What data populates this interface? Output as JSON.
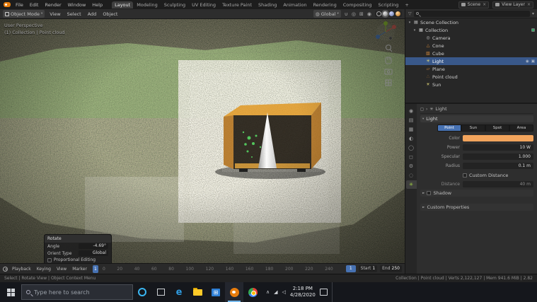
{
  "colors": {
    "accent": "#e87d0d",
    "selection_blue": "#4772b3",
    "crate_top": "#e09a28",
    "crate_side": "#b2701a",
    "crate_front": "#1a140b",
    "cone": "#ededed",
    "marker_dots": "#3ec24b",
    "light_color_swatch": "#f2a45c"
  },
  "glyphs": {
    "caret": "▾",
    "collapsed": "►",
    "expanded": "▾",
    "close": "×",
    "check": "✓",
    "chevron_right": "›",
    "tray_chevron": "∧",
    "tray_net": "◢",
    "tray_vol": "◁",
    "eye": "◉",
    "screen": "▣",
    "funnel": "▽",
    "proportional": "◎",
    "magnet": "∪",
    "globe": "◍",
    "grid": "⊞"
  },
  "topbar": {
    "menus": [
      {
        "label": "File"
      },
      {
        "label": "Edit"
      },
      {
        "label": "Render"
      },
      {
        "label": "Window"
      },
      {
        "label": "Help"
      }
    ],
    "tabs": [
      {
        "label": "Layout"
      },
      {
        "label": "Modeling"
      },
      {
        "label": "Sculpting"
      },
      {
        "label": "UV Editing"
      },
      {
        "label": "Texture Paint"
      },
      {
        "label": "Shading"
      },
      {
        "label": "Animation"
      },
      {
        "label": "Rendering"
      },
      {
        "label": "Compositing"
      },
      {
        "label": "Scripting"
      },
      {
        "label": "+"
      }
    ],
    "scene_label": "Scene",
    "view_layer_label": "View Layer"
  },
  "viewport_header": {
    "mode": "Object Mode",
    "menus": [
      {
        "label": "View"
      },
      {
        "label": "Select"
      },
      {
        "label": "Add"
      },
      {
        "label": "Object"
      }
    ],
    "orientation": "Global"
  },
  "viewport": {
    "overlay_lines": [
      "User Perspective",
      "(1) Collection | Point cloud"
    ]
  },
  "rotate_panel": {
    "title": "Rotate",
    "rows": [
      {
        "label": "Angle",
        "value": "-4.69°"
      },
      {
        "label": "Orient Type",
        "value": "Global"
      }
    ],
    "checkbox_label": "Proportional Editing"
  },
  "outliner": {
    "rows": [
      {
        "label": "Scene Collection",
        "icon": "▤"
      },
      {
        "label": "Collection",
        "icon": "▦"
      },
      {
        "label": "Camera",
        "icon": "◎"
      },
      {
        "label": "Cone",
        "icon": "△"
      },
      {
        "label": "Cube",
        "icon": "▧"
      },
      {
        "label": "Light",
        "icon": "✳"
      },
      {
        "label": "Plane",
        "icon": "▱"
      },
      {
        "label": "Point cloud",
        "icon": "∴"
      },
      {
        "label": "Sun",
        "icon": "☀"
      }
    ]
  },
  "properties": {
    "tabs": [
      {
        "name": "render",
        "glyph": "◉"
      },
      {
        "name": "output",
        "glyph": "▤"
      },
      {
        "name": "view-layer",
        "glyph": "▦"
      },
      {
        "name": "scene",
        "glyph": "◐"
      },
      {
        "name": "world",
        "glyph": "◯"
      },
      {
        "name": "object",
        "glyph": "◻"
      },
      {
        "name": "modifiers",
        "glyph": "⚙"
      },
      {
        "name": "physics",
        "glyph": "◌"
      },
      {
        "name": "object-data",
        "glyph": "✳"
      }
    ],
    "breadcrumb_object": "Light",
    "light_section": "Light",
    "type_buttons": [
      {
        "label": "Point"
      },
      {
        "label": "Sun"
      },
      {
        "label": "Spot"
      },
      {
        "label": "Area"
      }
    ],
    "fields": {
      "color_label": "Color",
      "power_label": "Power",
      "power_value": "10 W",
      "specular_label": "Specular",
      "specular_value": "1.000",
      "radius_label": "Radius",
      "radius_value": "0.1 m",
      "custom_distance_label": "Custom Distance",
      "distance_label": "Distance",
      "distance_value": "40 m"
    },
    "collapsed_sections": [
      {
        "label": "Shadow"
      },
      {
        "label": "Custom Properties"
      }
    ]
  },
  "timeline": {
    "menus": [
      {
        "label": "Playback"
      },
      {
        "label": "Keying"
      },
      {
        "label": "View"
      },
      {
        "label": "Marker"
      }
    ],
    "ticks": [
      "0",
      "20",
      "40",
      "60",
      "80",
      "100",
      "120",
      "140",
      "160",
      "180",
      "200",
      "220",
      "240"
    ],
    "transport": [
      "|◀",
      "◀◀",
      "◀",
      "▶",
      "▶▶",
      "▶|"
    ],
    "current_frame": "1",
    "start_label": "Start",
    "start_value": "1",
    "end_label": "End",
    "end_value": "250"
  },
  "statusbar": {
    "left_hints": "Select  |  Rotate View  |  Object Context Menu",
    "right_stats": "Collection | Point cloud  |  Verts 2,122,127  |  Mem 941.6 MiB  |  2.82"
  },
  "taskbar": {
    "search_placeholder": "Type here to search",
    "time": "2:18 PM",
    "date": "4/28/2020"
  }
}
